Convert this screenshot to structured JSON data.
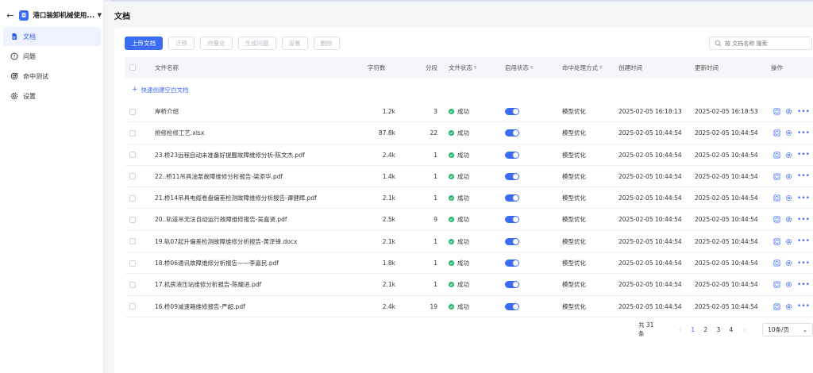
{
  "sidebar": {
    "app_title": "港口装卸机械使用...",
    "items": [
      {
        "label": "文档",
        "icon": "document-icon",
        "active": true
      },
      {
        "label": "问题",
        "icon": "question-icon",
        "active": false
      },
      {
        "label": "命中测试",
        "icon": "target-icon",
        "active": false
      },
      {
        "label": "设置",
        "icon": "gear-icon",
        "active": false
      }
    ]
  },
  "page": {
    "title": "文档"
  },
  "toolbar": {
    "upload": "上传文档",
    "migrate": "迁移",
    "vectorize": "向量化",
    "generate_questions": "生成问题",
    "settings": "设置",
    "delete": "删除"
  },
  "search": {
    "placeholder": "按 文档名称 搜索"
  },
  "table": {
    "headers": {
      "name": "文件名称",
      "chars": "字符数",
      "segments": "分段",
      "file_status": "文件状态",
      "enable_status": "启用状态",
      "hit_method": "命中处理方式",
      "created": "创建时间",
      "updated": "更新时间",
      "actions": "操作"
    },
    "quick_create": "快速创建空白文档",
    "rows": [
      {
        "name": "岸桥介绍",
        "chars": "1.2k",
        "segments": "3",
        "status": "成功",
        "enabled": true,
        "method": "模型优化",
        "created": "2025-02-05 16:18:13",
        "updated": "2025-02-05 16:18:53"
      },
      {
        "name": "抢修检修工艺.xlsx",
        "chars": "87.8k",
        "segments": "22",
        "status": "成功",
        "enabled": true,
        "method": "模型优化",
        "created": "2025-02-05 10:44:54",
        "updated": "2025-02-05 10:44:54"
      },
      {
        "name": "23.桥23远程自动未准备好提醒故障维修分析-陈文杰.pdf",
        "chars": "2.4k",
        "segments": "1",
        "status": "成功",
        "enabled": true,
        "method": "模型优化",
        "created": "2025-02-05 10:44:54",
        "updated": "2025-02-05 10:44:54"
      },
      {
        "name": "22..桥11吊具油泵故障维修分析报告-梁添华.pdf",
        "chars": "1.4k",
        "segments": "1",
        "status": "成功",
        "enabled": true,
        "method": "模型优化",
        "created": "2025-02-05 10:44:54",
        "updated": "2025-02-05 10:44:54"
      },
      {
        "name": "21.桥14吊具电缆卷盘偏差检测故障维修分析报告-谭健辉.pdf",
        "chars": "2.1k",
        "segments": "1",
        "status": "成功",
        "enabled": true,
        "method": "模型优化",
        "created": "2025-02-05 10:44:54",
        "updated": "2025-02-05 10:44:54"
      },
      {
        "name": "20..轨道吊无法自动运行故障维修报告-吴嘉贤.pdf",
        "chars": "2.5k",
        "segments": "9",
        "status": "成功",
        "enabled": true,
        "method": "模型优化",
        "created": "2025-02-05 10:44:54",
        "updated": "2025-02-05 10:44:54"
      },
      {
        "name": "19.轨07起升偏差检测故障维修分析报告-黄泽锋.docx",
        "chars": "2.1k",
        "segments": "1",
        "status": "成功",
        "enabled": true,
        "method": "模型优化",
        "created": "2025-02-05 10:44:54",
        "updated": "2025-02-05 10:44:54"
      },
      {
        "name": "18.桥06通讯故障维修分析报告——李嘉民.pdf",
        "chars": "1.8k",
        "segments": "1",
        "status": "成功",
        "enabled": true,
        "method": "模型优化",
        "created": "2025-02-05 10:44:54",
        "updated": "2025-02-05 10:44:54"
      },
      {
        "name": "17.机房液压站维修分析报告-陈耀进.pdf",
        "chars": "2.1k",
        "segments": "1",
        "status": "成功",
        "enabled": true,
        "method": "模型优化",
        "created": "2025-02-05 10:44:54",
        "updated": "2025-02-05 10:44:54"
      },
      {
        "name": "16.桥09减速箱维修报告-严超.pdf",
        "chars": "2.4k",
        "segments": "19",
        "status": "成功",
        "enabled": true,
        "method": "模型优化",
        "created": "2025-02-05 10:44:54",
        "updated": "2025-02-05 10:44:54"
      }
    ]
  },
  "pagination": {
    "total": "共 31 条",
    "pages": [
      "1",
      "2",
      "3",
      "4"
    ],
    "current": "1",
    "page_size": "10条/页"
  },
  "colors": {
    "accent": "#3b6cf6",
    "success": "#2bb673"
  }
}
